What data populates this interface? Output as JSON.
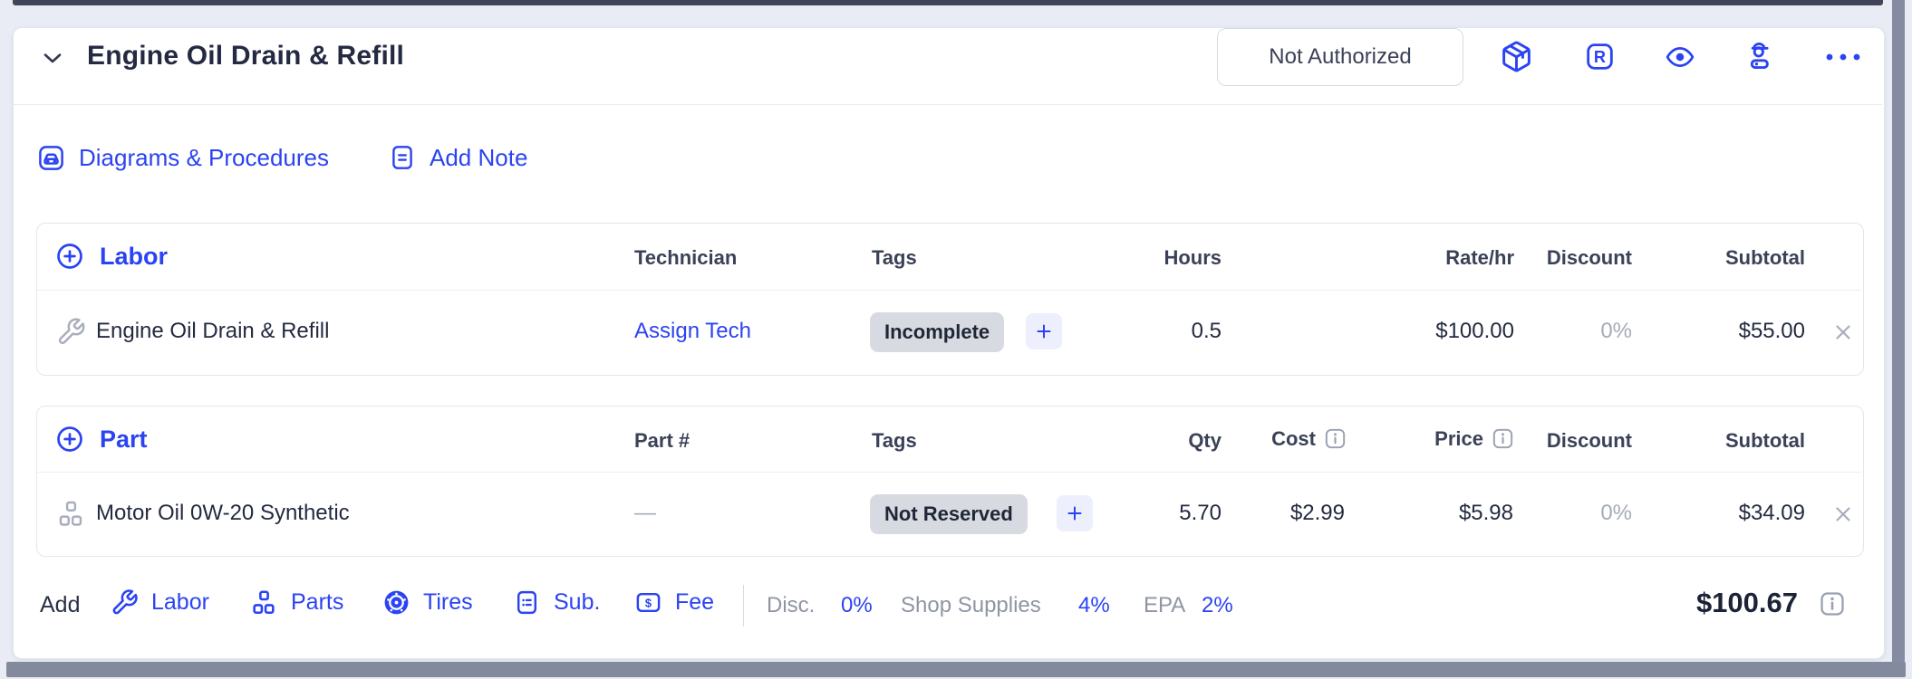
{
  "accent_blue": "#2b43f2",
  "header": {
    "title": "Engine Oil Drain & Refill",
    "status_button": "Not Authorized",
    "icons": [
      "package-icon",
      "r-badge-icon",
      "eye-icon",
      "technician-icon",
      "more-icon"
    ],
    "r_badge_letter": "R"
  },
  "links": {
    "diagrams": "Diagrams & Procedures",
    "add_note": "Add Note"
  },
  "labor": {
    "section_label": "Labor",
    "columns": [
      "Technician",
      "Tags",
      "Hours",
      "Rate/hr",
      "Discount",
      "Subtotal"
    ],
    "row": {
      "name": "Engine Oil Drain & Refill",
      "technician": "Assign Tech",
      "tag": "Incomplete",
      "hours": "0.5",
      "rate": "$100.00",
      "discount": "0%",
      "subtotal": "$55.00"
    }
  },
  "parts": {
    "section_label": "Part",
    "columns": [
      "Part #",
      "Tags",
      "Qty",
      "Cost",
      "Price",
      "Discount",
      "Subtotal"
    ],
    "row": {
      "name": "Motor Oil 0W-20 Synthetic",
      "part_number": "—",
      "tag": "Not Reserved",
      "qty": "5.70",
      "cost": "$2.99",
      "price": "$5.98",
      "discount": "0%",
      "subtotal": "$34.09"
    }
  },
  "footer": {
    "add_label": "Add",
    "add_links": [
      "Labor",
      "Parts",
      "Tires",
      "Sub.",
      "Fee"
    ],
    "fee_symbol": "$",
    "disc_label": "Disc.",
    "disc_value": "0%",
    "shop_supplies_label": "Shop Supplies",
    "shop_supplies_value": "4%",
    "epa_label": "EPA",
    "epa_value": "2%",
    "total": "$100.67"
  }
}
